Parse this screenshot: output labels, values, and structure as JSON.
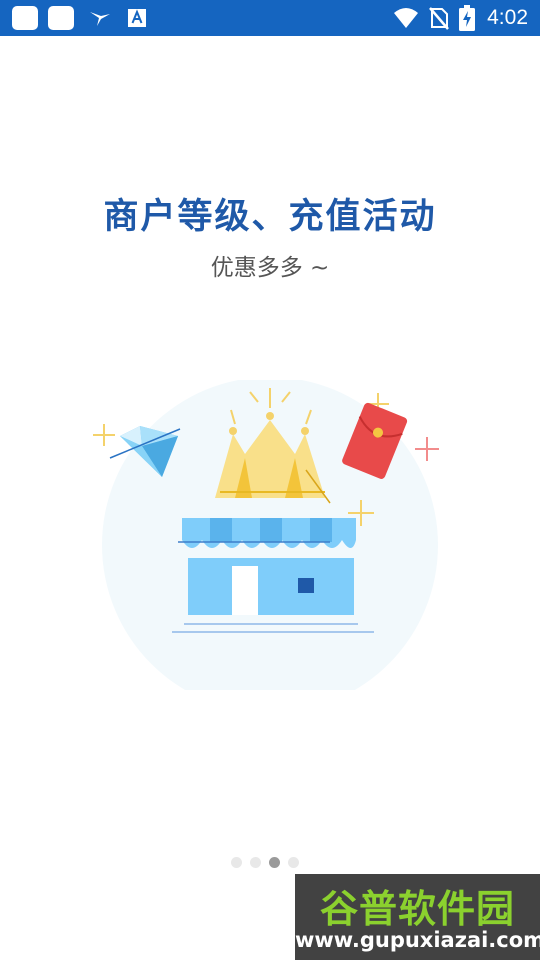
{
  "status_bar": {
    "time": "4:02",
    "icons": [
      "app-icon",
      "app-icon",
      "bird-icon",
      "a-icon",
      "wifi-icon",
      "no-sim-icon",
      "battery-charging-icon"
    ],
    "background": "#1565c0"
  },
  "onboarding": {
    "title": "商户等级、充值活动",
    "subtitle": "优惠多多 ~",
    "title_color": "#1f59a8",
    "illustration_icons": [
      "diamond-icon",
      "crown-icon",
      "red-envelope-icon",
      "storefront-icon",
      "sparkle-icon"
    ]
  },
  "pager": {
    "total": 4,
    "current": 3
  },
  "watermark": {
    "title": "谷普软件园",
    "url": "www.gupuxiazai.com"
  }
}
